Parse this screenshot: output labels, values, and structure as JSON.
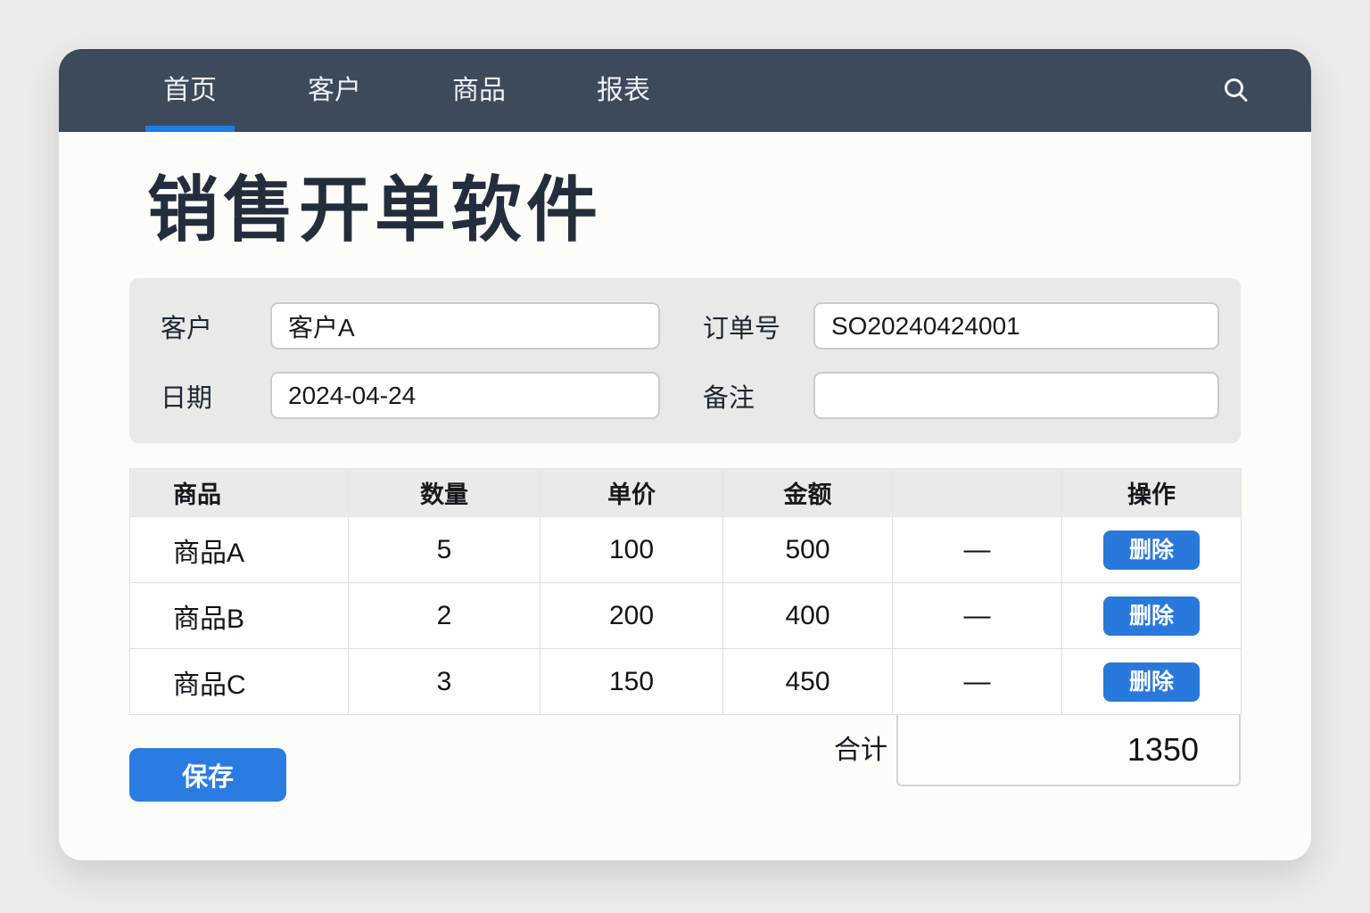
{
  "page": {
    "bg_color": "#edecea",
    "navbar_color": "#3d4a5b",
    "accent_color": "#2b7ce2",
    "underline_color": "#1e7ce9"
  },
  "nav": {
    "tabs": [
      {
        "label": "首页",
        "active": true
      },
      {
        "label": "客户",
        "active": false
      },
      {
        "label": "商品",
        "active": false
      },
      {
        "label": "报表",
        "active": false
      }
    ],
    "search_icon": "magnifier"
  },
  "header": {
    "title": "销售开单软件"
  },
  "form": {
    "fields": [
      {
        "label": "客户",
        "value": "客户A"
      },
      {
        "label": "订单号",
        "value": "SO20240424001"
      },
      {
        "label": "日期",
        "value": "2024-04-24"
      },
      {
        "label": "备注",
        "value": ""
      }
    ]
  },
  "table": {
    "headers": [
      "商品",
      "数量",
      "单价",
      "金额",
      "",
      "操作"
    ],
    "rows": [
      {
        "product": "商品A",
        "qty": "5",
        "price": "100",
        "amount": "500",
        "dash": "—",
        "action": "删除"
      },
      {
        "product": "商品B",
        "qty": "2",
        "price": "200",
        "amount": "400",
        "dash": "—",
        "action": "删除"
      },
      {
        "product": "商品C",
        "qty": "3",
        "price": "150",
        "amount": "450",
        "dash": "—",
        "action": "删除"
      }
    ],
    "footer": {
      "total_label": "合计",
      "total_value": "1350"
    }
  },
  "actions": {
    "save_label": "保存"
  }
}
